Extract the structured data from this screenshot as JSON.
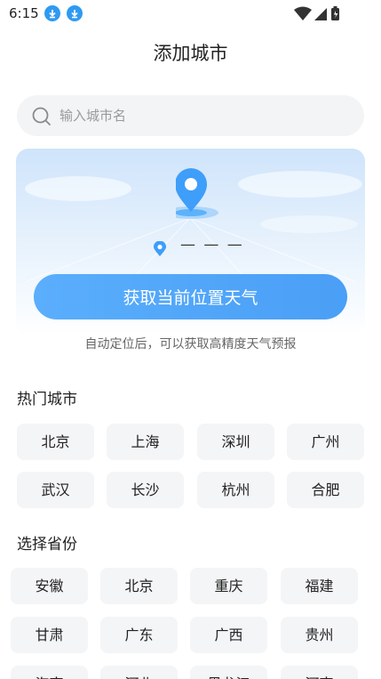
{
  "status_bar": {
    "time": "6:15"
  },
  "header": {
    "title": "添加城市"
  },
  "search": {
    "placeholder": "输入城市名",
    "value": ""
  },
  "locate": {
    "current_location": "— — —",
    "button_label": "获取当前位置天气",
    "hint": "自动定位后，可以获取高精度天气预报"
  },
  "hot_cities": {
    "title": "热门城市",
    "items": [
      "北京",
      "上海",
      "深圳",
      "广州",
      "武汉",
      "长沙",
      "杭州",
      "合肥"
    ]
  },
  "provinces": {
    "title": "选择省份",
    "items": [
      "安徽",
      "北京",
      "重庆",
      "福建",
      "甘肃",
      "广东",
      "广西",
      "贵州",
      "海南",
      "河北",
      "黑龙江",
      "河南"
    ]
  },
  "colors": {
    "accent": "#4a9ff6",
    "chip_bg": "#f4f5f7",
    "download_icon": "#2f9af2"
  }
}
